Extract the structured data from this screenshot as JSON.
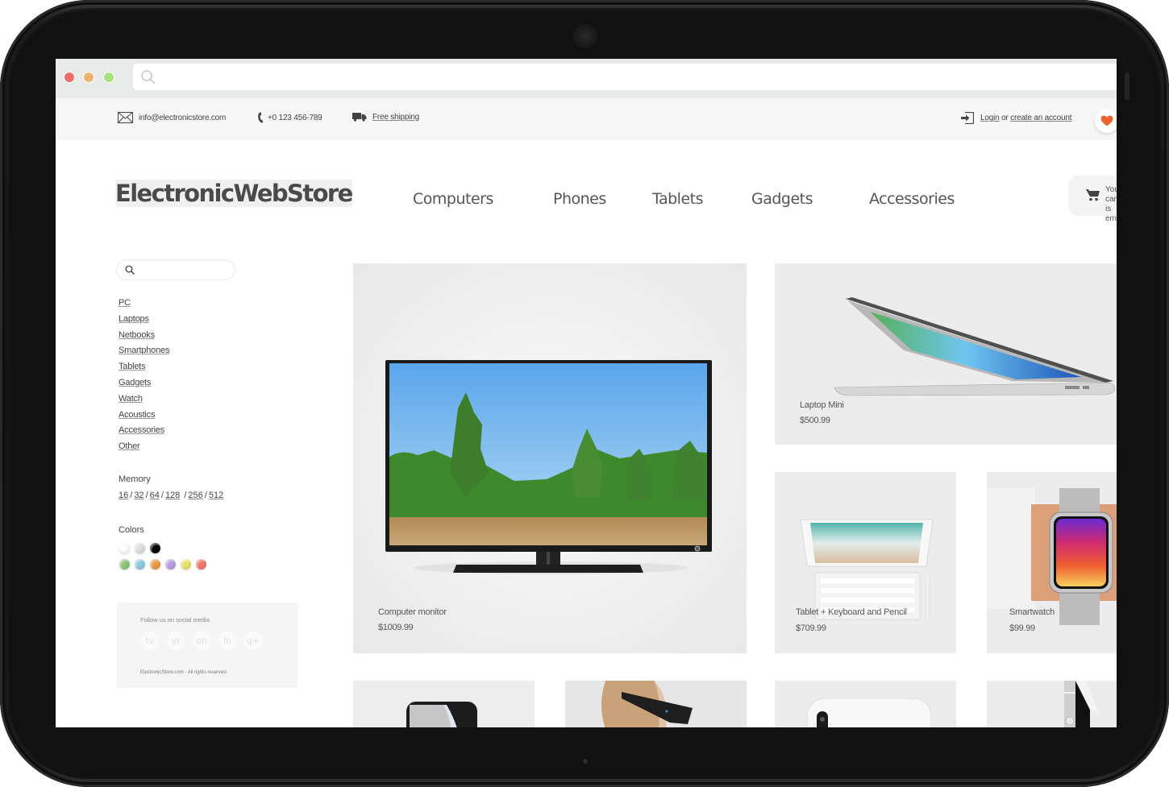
{
  "browser": {
    "url_value": "",
    "controls": [
      "close",
      "minimize",
      "maximize"
    ]
  },
  "info_bar": {
    "email": "info@electronicstore.com",
    "phone": "+0 123 456-789",
    "shipping": "Free shipping",
    "login": "Login",
    "or": "or",
    "create_account": "create an account",
    "icons": {
      "email": "envelope-icon",
      "phone": "phone-icon",
      "shipping": "truck-icon",
      "login": "login-icon",
      "favorites": "heart-icon"
    },
    "heart_color": "#f0622e"
  },
  "header": {
    "logo": "ElectronicWebStore",
    "nav": [
      "Computers",
      "Phones",
      "Tablets",
      "Gadgets",
      "Accessories"
    ],
    "cart": {
      "line1": "Your cart",
      "line2": "is empty",
      "icon": "cart-icon"
    }
  },
  "sidebar": {
    "search_placeholder": "",
    "categories": [
      "PC",
      "Laptops",
      "Netbooks",
      "Smartphones",
      "Tablets",
      "Gadgets",
      "Watch",
      "Acoustics",
      "Accessories",
      "Other"
    ],
    "memory_title": "Memory",
    "memory_options": [
      "16",
      "32",
      "64",
      "128",
      "256",
      "512"
    ],
    "colors_title": "Colors",
    "colors_row1": [
      "#ffffff",
      "#dddddd",
      "#000000"
    ],
    "colors_row2": [
      "#8fc47a",
      "#8ecbe0",
      "#eb9a48",
      "#b9a0e0",
      "#e8e46e",
      "#f07a6e"
    ],
    "social": {
      "title": "Follow us on social media",
      "icons": [
        "tv",
        "yt",
        "on",
        "lb",
        "q+"
      ],
      "copyright": "ElectronicStore.com - All rights reserved"
    }
  },
  "products": [
    {
      "name": "Computer monitor",
      "price": "$1009.99"
    },
    {
      "name": "Laptop Mini",
      "price": "$500.99"
    },
    {
      "name": "Tablet + Keyboard and Pencil",
      "price": "$709.99"
    },
    {
      "name": "Smartwatch",
      "price": "$99.99"
    }
  ],
  "partial_products": [
    "screen-protector",
    "vr-headset",
    "smartphone-white",
    "smartphone-side"
  ]
}
